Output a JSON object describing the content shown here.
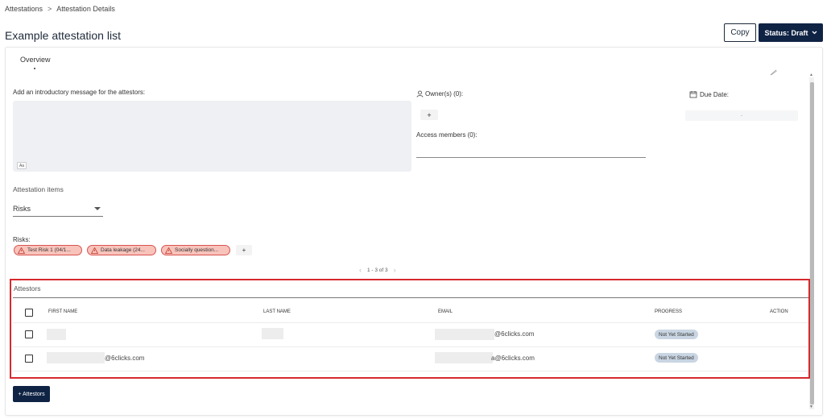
{
  "breadcrumb": {
    "items": [
      "Attestations",
      "Attestation Details"
    ],
    "separator": ">"
  },
  "page": {
    "title": "Example attestation list"
  },
  "header_actions": {
    "copy_label": "Copy",
    "status_label": "Status: Draft"
  },
  "tabs": {
    "overview": "Overview"
  },
  "form": {
    "intro_label": "Add an introductory message for the attestors:",
    "editor_badge": "Aa",
    "owners_label": "Owner(s) (0):",
    "owners_add": "+",
    "access_label": "Access members (0):",
    "due_label": "Due Date:",
    "due_value": "-",
    "attestation_items_label": "Attestation items",
    "items_type": "Risks",
    "risks_label": "Risks:",
    "risks_add": "+",
    "risks": [
      {
        "label": "Test Risk 1 (04/1..."
      },
      {
        "label": "Data leakage (24..."
      },
      {
        "label": "Socially question..."
      }
    ]
  },
  "pager": {
    "text": "1 - 3 of 3"
  },
  "attestors": {
    "title": "Attestors",
    "columns": {
      "first_name": "FIRST NAME",
      "last_name": "LAST NAME",
      "email": "EMAIL",
      "progress": "PROGRESS",
      "action": "ACTION"
    },
    "rows": [
      {
        "first_name_suffix": "",
        "email_suffix": "@6clicks.com",
        "progress": "Not Yet Started"
      },
      {
        "first_name_suffix": "@6clicks.com",
        "email_suffix": "a@6clicks.com",
        "progress": "Not Yet Started"
      }
    ],
    "add_button": "+ Attestors"
  },
  "colors": {
    "primary": "#0f2344",
    "highlight_border": "#d6292f",
    "chip_bg": "#f8c3bb",
    "badge_bg": "#c9d5e2"
  }
}
